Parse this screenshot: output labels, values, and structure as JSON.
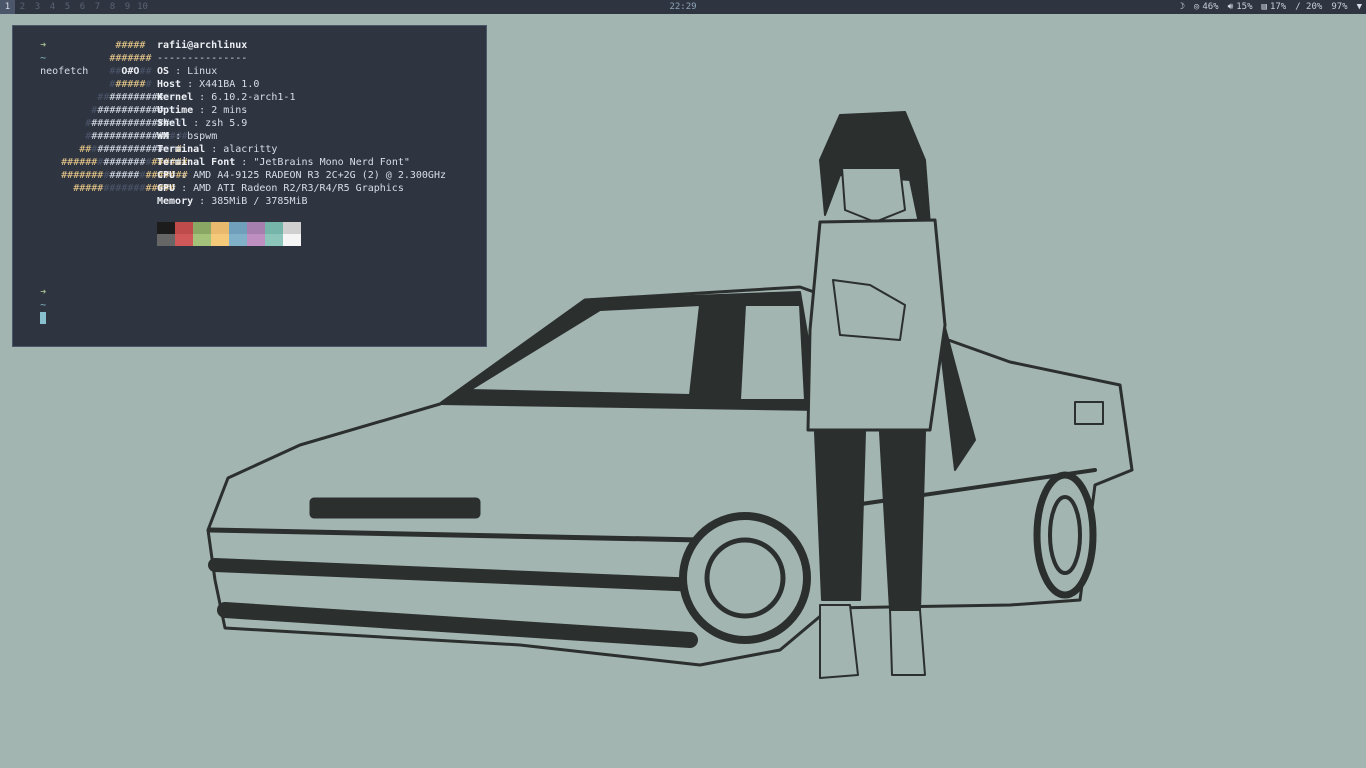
{
  "topbar": {
    "workspaces": [
      "1",
      "2",
      "3",
      "4",
      "5",
      "6",
      "7",
      "8",
      "9",
      "10"
    ],
    "active_workspace": "1",
    "clock": "22:29",
    "status": {
      "brightness_icon": "moon-icon",
      "cpu": "46%",
      "volume": "15%",
      "memory": "17%",
      "disk": "/ 20%",
      "battery": "97%"
    }
  },
  "terminal": {
    "command_arrow": "➜",
    "tilde": "~",
    "command": "neofetch",
    "userhost": "rafii@archlinux",
    "separator": "---------------",
    "info": [
      {
        "key": "OS",
        "value": "Linux"
      },
      {
        "key": "Host",
        "value": "X441BA 1.0"
      },
      {
        "key": "Kernel",
        "value": "6.10.2-arch1-1"
      },
      {
        "key": "Uptime",
        "value": "2 mins"
      },
      {
        "key": "Shell",
        "value": "zsh 5.9"
      },
      {
        "key": "WM",
        "value": "bspwm"
      },
      {
        "key": "Terminal",
        "value": "alacritty"
      },
      {
        "key": "Terminal Font",
        "value": "\"JetBrains Mono Nerd Font\""
      },
      {
        "key": "CPU",
        "value": "AMD A4-9125 RADEON R3 2C+2G (2) @ 2.300GHz"
      },
      {
        "key": "GPU",
        "value": "AMD ATI Radeon R2/R3/R4/R5 Graphics"
      },
      {
        "key": "Memory",
        "value": "385MiB / 3785MiB"
      }
    ],
    "palette_top": [
      "#1c1c1c",
      "#bf4b4b",
      "#8aa864",
      "#e9b96e",
      "#6f9fba",
      "#a77fae",
      "#75b5aa",
      "#d0d0d0"
    ],
    "palette_bottom": [
      "#666666",
      "#d05858",
      "#a5c27b",
      "#f5c97a",
      "#81b0c9",
      "#bf8fc2",
      "#8cc6bb",
      "#f5f5f5"
    ]
  }
}
